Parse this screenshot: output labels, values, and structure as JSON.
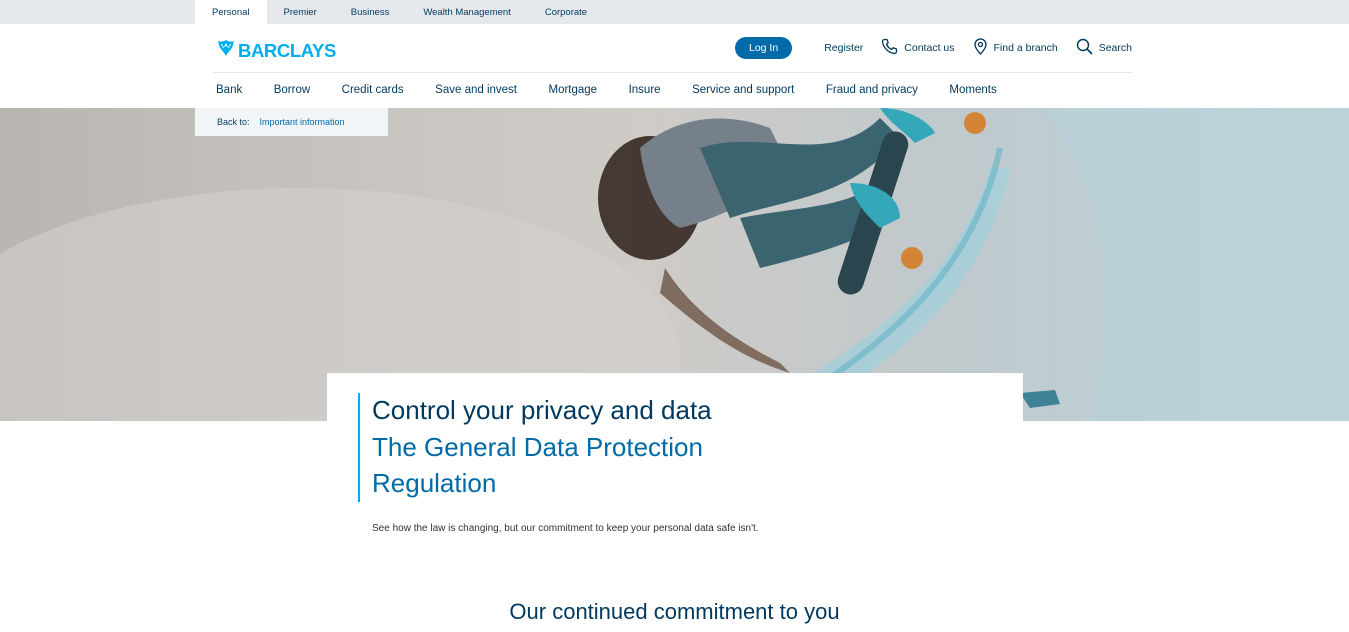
{
  "segments": [
    {
      "label": "Personal",
      "active": true
    },
    {
      "label": "Premier"
    },
    {
      "label": "Business"
    },
    {
      "label": "Wealth Management"
    },
    {
      "label": "Corporate"
    }
  ],
  "brand": {
    "name": "BARCLAYS",
    "icon": "eagle-icon",
    "color": "#00aeef"
  },
  "utility": {
    "login_label": "Log In",
    "register_label": "Register",
    "contact_label": "Contact us",
    "branch_label": "Find a branch",
    "search_label": "Search"
  },
  "nav": {
    "items": [
      {
        "label": "Bank"
      },
      {
        "label": "Borrow"
      },
      {
        "label": "Credit cards"
      },
      {
        "label": "Save and invest"
      },
      {
        "label": "Mortgage"
      },
      {
        "label": "Insure"
      },
      {
        "label": "Service and support"
      },
      {
        "label": "Fraud and privacy"
      },
      {
        "label": "Moments"
      }
    ]
  },
  "breadcrumb": {
    "prefix": "Back to:",
    "link": "Important information"
  },
  "hero": {
    "title": "Control your privacy and data",
    "subtitle": "The General Data Protection Regulation",
    "intro": "See how the law is changing, but our commitment to keep your personal data safe isn't."
  },
  "section": {
    "heading": "Our continued commitment to you"
  },
  "colors": {
    "primary": "#00395d",
    "accent": "#00aeef",
    "link": "#006ba8"
  }
}
